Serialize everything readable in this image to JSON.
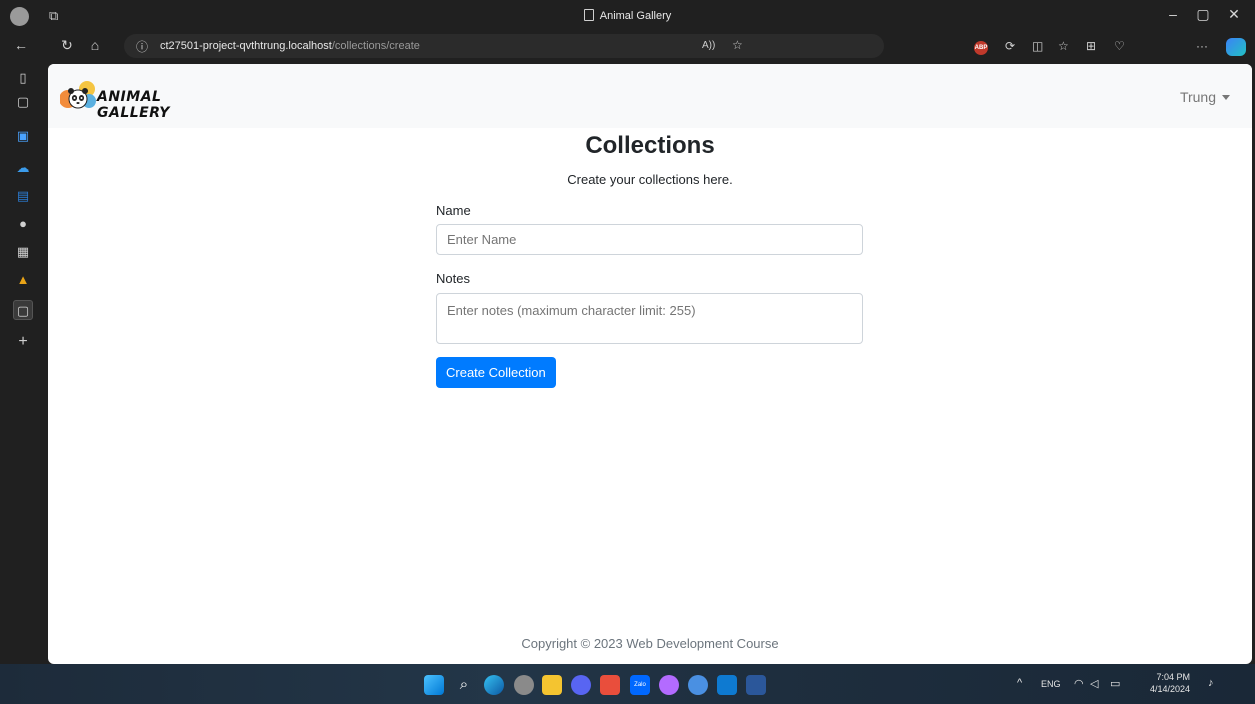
{
  "window": {
    "title": "Animal Gallery"
  },
  "browser": {
    "url_host": "ct27501-project-qvthtrung.localhost",
    "url_path": "/collections/create",
    "abp_label": "ABP"
  },
  "site": {
    "brand": "ANIMAL GALLERY",
    "user": "Trung"
  },
  "page": {
    "title": "Collections",
    "subtitle": "Create your collections here.",
    "name_label": "Name",
    "name_placeholder": "Enter Name",
    "notes_label": "Notes",
    "notes_placeholder": "Enter notes (maximum character limit: 255)",
    "submit_label": "Create Collection",
    "footer": "Copyright © 2023 Web Development Course"
  },
  "taskbar": {
    "language": "ENG",
    "time": "7:04 PM",
    "date": "4/14/2024"
  },
  "colors": {
    "primary": "#007bff",
    "navbar_bg": "#f8f9fa",
    "chrome_bg": "#202020"
  }
}
